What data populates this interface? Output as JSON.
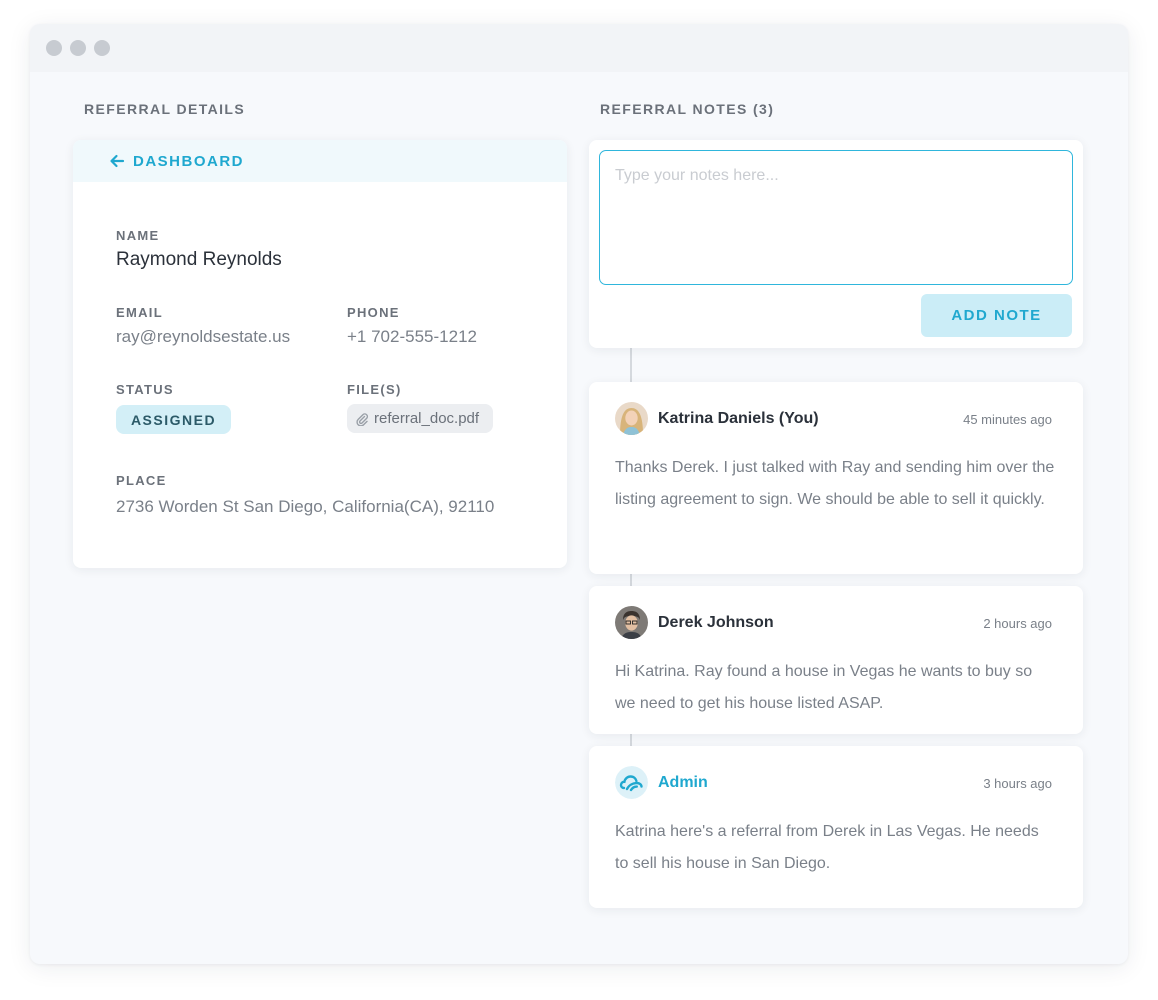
{
  "details": {
    "section_label": "REFERRAL DETAILS",
    "back_label": "DASHBOARD",
    "name_label": "NAME",
    "name_value": "Raymond Reynolds",
    "email_label": "EMAIL",
    "email_value": "ray@reynoldsestate.us",
    "phone_label": "PHONE",
    "phone_value": "+1 702-555-1212",
    "status_label": "STATUS",
    "status_value": "ASSIGNED",
    "files_label": "FILE(S)",
    "file_name": "referral_doc.pdf",
    "place_label": "PLACE",
    "place_value": "2736 Worden St San Diego, California(CA), 92110"
  },
  "notes": {
    "section_label": "REFERRAL NOTES (3)",
    "input_placeholder": "Type your notes here...",
    "add_button": "ADD NOTE",
    "items": [
      {
        "author": "Katrina Daniels (You)",
        "time": "45 minutes ago",
        "body": "Thanks Derek.  I just talked with Ray and sending him over the listing agreement to sign.  We should be able to sell it quickly."
      },
      {
        "author": "Derek Johnson",
        "time": "2 hours ago",
        "body": "Hi Katrina.  Ray found a house in Vegas he wants to buy so we need to get his house listed ASAP."
      },
      {
        "author": "Admin",
        "time": "3 hours ago",
        "body": "Katrina here's a referral from Derek in Las Vegas.  He needs to sell his house in San Diego."
      }
    ]
  },
  "colors": {
    "accent": "#1fa8cf",
    "status_badge_bg": "#d3eff7",
    "window_bg": "#f7f9fc"
  }
}
